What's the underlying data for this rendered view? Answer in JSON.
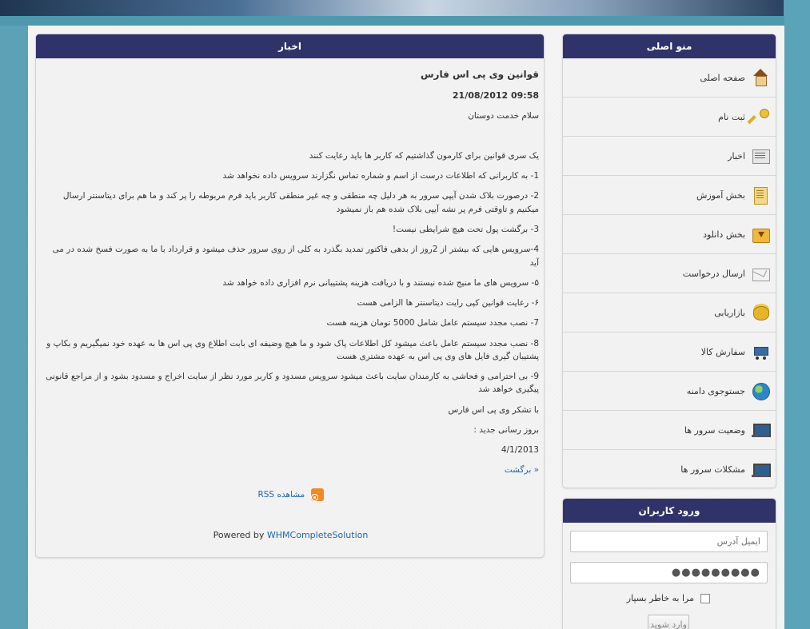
{
  "news": {
    "header": "اخبار",
    "title": "قوانین وی پی اس فارس",
    "date": "21/08/2012 09:58",
    "greeting": "سلام خدمت دوستان",
    "intro": "یک سری قوانین برای کارمون گذاشتیم که کاربر ها باید رعایت کنند",
    "rules": [
      "1- به کاربرانی که اطلاعات درست از اسم و  شماره تماس نگزارند سرویس داده نخواهد شد",
      "2- درصورت بلاک شدن آیپی سرور  به هر دلیل چه منطقی و چه غیر منطقی کاربر باید فرم مربوطه را پر کند و ما هم برای دیتاسنتر ارسال میکنیم و تاوقتی فرم پر نشه آیپی بلاک شده هم باز نمیشود",
      "3- برگشت پول تحت هیچ شرایطی نیست!",
      "4-سرویس هایی که بیشتر از 2روز از بدهی فاکتور تمدید بگذرد به کلی از روی سرور حذف میشود و قرارداد با ما به صورت فسخ شده در می آید",
      "۵- سرویس های ما منیج شده نیستند و با دریافت هزینه  پشتیبانی نرم افزاری داده خواهد شد",
      "۶- رعایت قوانین کپی رایت دیتاسنتر ها الزامی هست",
      "7- نصب مجدد سیستم عامل شامل 5000 تومان هزینه هست",
      "8- نصب مجدد سیستم عامل باعث میشود کل اطلاعات پاک شود و ما هیچ وضیفه ای بابت اطلاع وی پی اس ها به عهده خود نمیگیریم و بکاپ و پشتیبان گیری فایل های وی پی اس به عهده مشتری هست",
      "9- بی احترامی و فحاشی  به کارمندان سایت باعث میشود  سرویس  مسدود و کاربر مورد نظر از سایت اخراج و مسدود بشود و از مراجع قانونی پیگیری خواهد شد"
    ],
    "thanks": "با تشکر وی پی اس فارس",
    "update_label": "بروز رسانی جدید :",
    "update_date": "4/1/2013",
    "back_link": "« برگشت",
    "rss_link": "مشاهده RSS",
    "powered_prefix": "Powered by",
    "powered_link": "WHMCompleteSolution"
  },
  "menu": {
    "header": "منو اصلی",
    "items": [
      {
        "label": "صفحه اصلی",
        "icon": "home-icon"
      },
      {
        "label": "ثبت نام",
        "icon": "key-icon"
      },
      {
        "label": "اخبار",
        "icon": "newspaper-icon"
      },
      {
        "label": "بخش آموزش",
        "icon": "book-icon"
      },
      {
        "label": "بخش دانلود",
        "icon": "download-folder-icon"
      },
      {
        "label": "ارسال درخواست",
        "icon": "envelope-icon"
      },
      {
        "label": "بازاریابی",
        "icon": "coins-icon"
      },
      {
        "label": "سفارش کالا",
        "icon": "shopping-cart-icon"
      },
      {
        "label": "جستوجوی دامنه",
        "icon": "globe-icon"
      },
      {
        "label": "وضعیت سرور ها",
        "icon": "laptop-icon"
      },
      {
        "label": "مشکلات سرور ها",
        "icon": "laptop-icon"
      }
    ]
  },
  "login": {
    "header": "ورود کاربران",
    "email_placeholder": "ایمیل آدرس",
    "password_value": "●●●●●●●●●",
    "remember_label": "مرا به خاطر بسپار",
    "submit_label": "وارد شوید"
  }
}
